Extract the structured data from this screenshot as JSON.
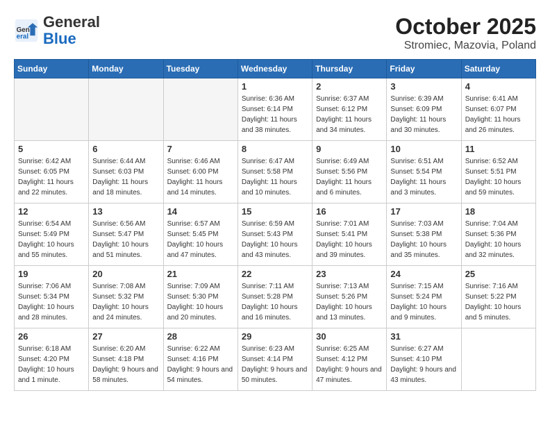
{
  "header": {
    "logo_line1": "General",
    "logo_line2": "Blue",
    "month_title": "October 2025",
    "subtitle": "Stromiec, Mazovia, Poland"
  },
  "weekdays": [
    "Sunday",
    "Monday",
    "Tuesday",
    "Wednesday",
    "Thursday",
    "Friday",
    "Saturday"
  ],
  "weeks": [
    [
      {
        "day": "",
        "empty": true
      },
      {
        "day": "",
        "empty": true
      },
      {
        "day": "",
        "empty": true
      },
      {
        "day": "1",
        "sunrise": "6:36 AM",
        "sunset": "6:14 PM",
        "daylight": "11 hours and 38 minutes."
      },
      {
        "day": "2",
        "sunrise": "6:37 AM",
        "sunset": "6:12 PM",
        "daylight": "11 hours and 34 minutes."
      },
      {
        "day": "3",
        "sunrise": "6:39 AM",
        "sunset": "6:09 PM",
        "daylight": "11 hours and 30 minutes."
      },
      {
        "day": "4",
        "sunrise": "6:41 AM",
        "sunset": "6:07 PM",
        "daylight": "11 hours and 26 minutes."
      }
    ],
    [
      {
        "day": "5",
        "sunrise": "6:42 AM",
        "sunset": "6:05 PM",
        "daylight": "11 hours and 22 minutes."
      },
      {
        "day": "6",
        "sunrise": "6:44 AM",
        "sunset": "6:03 PM",
        "daylight": "11 hours and 18 minutes."
      },
      {
        "day": "7",
        "sunrise": "6:46 AM",
        "sunset": "6:00 PM",
        "daylight": "11 hours and 14 minutes."
      },
      {
        "day": "8",
        "sunrise": "6:47 AM",
        "sunset": "5:58 PM",
        "daylight": "11 hours and 10 minutes."
      },
      {
        "day": "9",
        "sunrise": "6:49 AM",
        "sunset": "5:56 PM",
        "daylight": "11 hours and 6 minutes."
      },
      {
        "day": "10",
        "sunrise": "6:51 AM",
        "sunset": "5:54 PM",
        "daylight": "11 hours and 3 minutes."
      },
      {
        "day": "11",
        "sunrise": "6:52 AM",
        "sunset": "5:51 PM",
        "daylight": "10 hours and 59 minutes."
      }
    ],
    [
      {
        "day": "12",
        "sunrise": "6:54 AM",
        "sunset": "5:49 PM",
        "daylight": "10 hours and 55 minutes."
      },
      {
        "day": "13",
        "sunrise": "6:56 AM",
        "sunset": "5:47 PM",
        "daylight": "10 hours and 51 minutes."
      },
      {
        "day": "14",
        "sunrise": "6:57 AM",
        "sunset": "5:45 PM",
        "daylight": "10 hours and 47 minutes."
      },
      {
        "day": "15",
        "sunrise": "6:59 AM",
        "sunset": "5:43 PM",
        "daylight": "10 hours and 43 minutes."
      },
      {
        "day": "16",
        "sunrise": "7:01 AM",
        "sunset": "5:41 PM",
        "daylight": "10 hours and 39 minutes."
      },
      {
        "day": "17",
        "sunrise": "7:03 AM",
        "sunset": "5:38 PM",
        "daylight": "10 hours and 35 minutes."
      },
      {
        "day": "18",
        "sunrise": "7:04 AM",
        "sunset": "5:36 PM",
        "daylight": "10 hours and 32 minutes."
      }
    ],
    [
      {
        "day": "19",
        "sunrise": "7:06 AM",
        "sunset": "5:34 PM",
        "daylight": "10 hours and 28 minutes."
      },
      {
        "day": "20",
        "sunrise": "7:08 AM",
        "sunset": "5:32 PM",
        "daylight": "10 hours and 24 minutes."
      },
      {
        "day": "21",
        "sunrise": "7:09 AM",
        "sunset": "5:30 PM",
        "daylight": "10 hours and 20 minutes."
      },
      {
        "day": "22",
        "sunrise": "7:11 AM",
        "sunset": "5:28 PM",
        "daylight": "10 hours and 16 minutes."
      },
      {
        "day": "23",
        "sunrise": "7:13 AM",
        "sunset": "5:26 PM",
        "daylight": "10 hours and 13 minutes."
      },
      {
        "day": "24",
        "sunrise": "7:15 AM",
        "sunset": "5:24 PM",
        "daylight": "10 hours and 9 minutes."
      },
      {
        "day": "25",
        "sunrise": "7:16 AM",
        "sunset": "5:22 PM",
        "daylight": "10 hours and 5 minutes."
      }
    ],
    [
      {
        "day": "26",
        "sunrise": "6:18 AM",
        "sunset": "4:20 PM",
        "daylight": "10 hours and 1 minute."
      },
      {
        "day": "27",
        "sunrise": "6:20 AM",
        "sunset": "4:18 PM",
        "daylight": "9 hours and 58 minutes."
      },
      {
        "day": "28",
        "sunrise": "6:22 AM",
        "sunset": "4:16 PM",
        "daylight": "9 hours and 54 minutes."
      },
      {
        "day": "29",
        "sunrise": "6:23 AM",
        "sunset": "4:14 PM",
        "daylight": "9 hours and 50 minutes."
      },
      {
        "day": "30",
        "sunrise": "6:25 AM",
        "sunset": "4:12 PM",
        "daylight": "9 hours and 47 minutes."
      },
      {
        "day": "31",
        "sunrise": "6:27 AM",
        "sunset": "4:10 PM",
        "daylight": "9 hours and 43 minutes."
      },
      {
        "day": "",
        "empty": true
      }
    ]
  ]
}
